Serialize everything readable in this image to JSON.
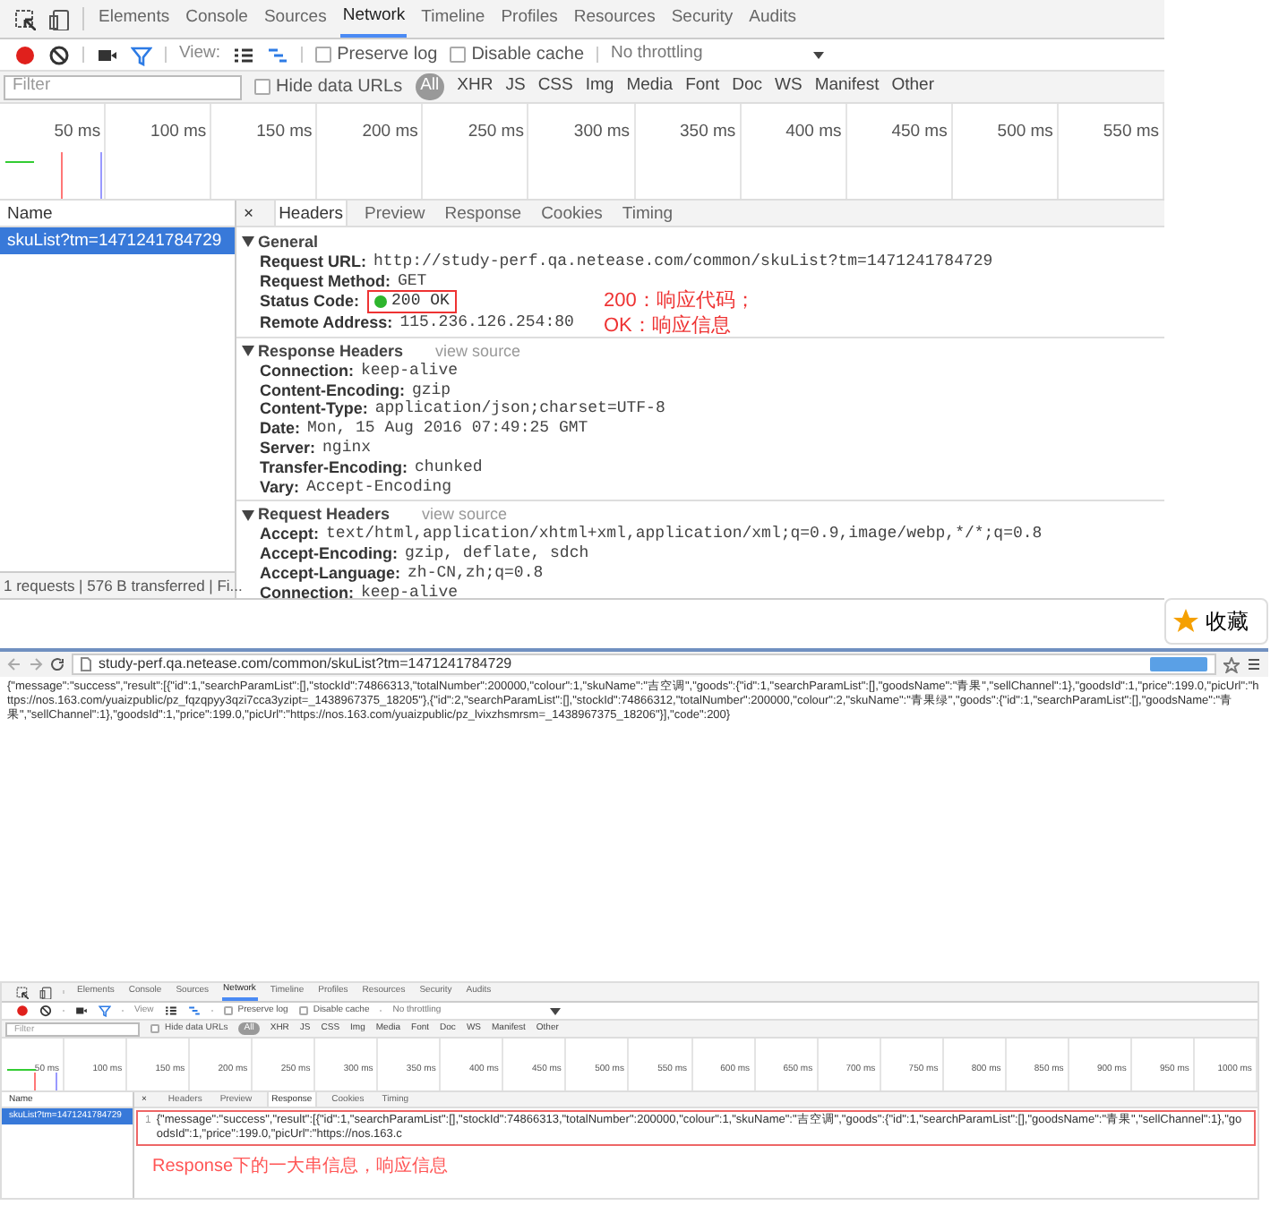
{
  "top_devtools": {
    "tabs": [
      {
        "label": "Elements",
        "selected": false
      },
      {
        "label": "Console",
        "selected": false
      },
      {
        "label": "Sources",
        "selected": false
      },
      {
        "label": "Network",
        "selected": true
      },
      {
        "label": "Timeline",
        "selected": false
      },
      {
        "label": "Profiles",
        "selected": false
      },
      {
        "label": "Resources",
        "selected": false
      },
      {
        "label": "Security",
        "selected": false
      },
      {
        "label": "Audits",
        "selected": false
      }
    ],
    "toolbar": {
      "view_label": "View:",
      "preserve_log": {
        "label": "Preserve log",
        "checked": false
      },
      "disable_cache": {
        "label": "Disable cache",
        "checked": false
      },
      "throttling": "No throttling"
    },
    "filter": {
      "placeholder": "Filter",
      "hide_data_urls": {
        "label": "Hide data URLs",
        "checked": false
      },
      "types": [
        {
          "label": "All",
          "selected": true
        },
        {
          "label": "XHR",
          "selected": false
        },
        {
          "label": "JS",
          "selected": false
        },
        {
          "label": "CSS",
          "selected": false
        },
        {
          "label": "Img",
          "selected": false
        },
        {
          "label": "Media",
          "selected": false
        },
        {
          "label": "Font",
          "selected": false
        },
        {
          "label": "Doc",
          "selected": false
        },
        {
          "label": "WS",
          "selected": false
        },
        {
          "label": "Manifest",
          "selected": false
        },
        {
          "label": "Other",
          "selected": false
        }
      ]
    },
    "timeline_ticks": [
      "50 ms",
      "100 ms",
      "150 ms",
      "200 ms",
      "250 ms",
      "300 ms",
      "350 ms",
      "400 ms",
      "450 ms",
      "500 ms",
      "550 ms"
    ],
    "requests": {
      "column": "Name",
      "items": [
        {
          "name": "skuList?tm=1471241784729",
          "selected": true
        }
      ],
      "status": "1 requests | 576 B transferred | Fi..."
    },
    "detail_close": "×",
    "detail_tabs": [
      {
        "label": "Headers",
        "selected": true
      },
      {
        "label": "Preview",
        "selected": false
      },
      {
        "label": "Response",
        "selected": false
      },
      {
        "label": "Cookies",
        "selected": false
      },
      {
        "label": "Timing",
        "selected": false
      }
    ],
    "sections": [
      {
        "title": "General",
        "expanded": true,
        "rows": [
          {
            "name": "Request URL:",
            "value": "http://study-perf.qa.netease.com/common/skuList?tm=1471241784729"
          },
          {
            "name": "Request Method:",
            "value": "GET"
          },
          {
            "name": "Status Code:",
            "value": "200 OK",
            "kind": "status"
          },
          {
            "name": "Remote Address:",
            "value": "115.236.126.254:80"
          }
        ]
      },
      {
        "title": "Response Headers",
        "expanded": true,
        "link": "view source",
        "rows": [
          {
            "name": "Connection:",
            "value": "keep-alive"
          },
          {
            "name": "Content-Encoding:",
            "value": "gzip"
          },
          {
            "name": "Content-Type:",
            "value": "application/json;charset=UTF-8"
          },
          {
            "name": "Date:",
            "value": "Mon, 15 Aug 2016 07:49:25 GMT"
          },
          {
            "name": "Server:",
            "value": "nginx"
          },
          {
            "name": "Transfer-Encoding:",
            "value": "chunked"
          },
          {
            "name": "Vary:",
            "value": "Accept-Encoding"
          }
        ]
      },
      {
        "title": "Request Headers",
        "expanded": true,
        "link": "view source",
        "rows": [
          {
            "name": "Accept:",
            "value": "text/html,application/xhtml+xml,application/xml;q=0.9,image/webp,*/*;q=0.8"
          },
          {
            "name": "Accept-Encoding:",
            "value": "gzip, deflate, sdch"
          },
          {
            "name": "Accept-Language:",
            "value": "zh-CN,zh;q=0.8"
          },
          {
            "name": "Connection:",
            "value": "keep-alive"
          }
        ]
      }
    ],
    "annotation": [
      "200：响应代码；",
      "OK：响应信息"
    ]
  },
  "favorite_button": "收藏",
  "browser": {
    "url": "study-perf.qa.netease.com/common/skuList?tm=1471241784729",
    "body": "{\"message\":\"success\",\"result\":[{\"id\":1,\"searchParamList\":[],\"stockId\":74866313,\"totalNumber\":200000,\"colour\":1,\"skuName\":\"吉空调\",\"goods\":{\"id\":1,\"searchParamList\":[],\"goodsName\":\"青果\",\"sellChannel\":1},\"goodsId\":1,\"price\":199.0,\"picUrl\":\"https://nos.163.com/yuaizpublic/pz_fqzqpyy3qzi7cca3yzipt=_1438967375_18205\"},{\"id\":2,\"searchParamList\":[],\"stockId\":74866312,\"totalNumber\":200000,\"colour\":2,\"skuName\":\"青果绿\",\"goods\":{\"id\":1,\"searchParamList\":[],\"goodsName\":\"青果\",\"sellChannel\":1},\"goodsId\":1,\"price\":199.0,\"picUrl\":\"https://nos.163.com/yuaizpublic/pz_lvixzhsmrsm=_1438967375_18206\"}],\"code\":200}"
  },
  "bottom_devtools": {
    "tabs": [
      {
        "label": "Elements",
        "selected": false
      },
      {
        "label": "Console",
        "selected": false
      },
      {
        "label": "Sources",
        "selected": false
      },
      {
        "label": "Network",
        "selected": true
      },
      {
        "label": "Timeline",
        "selected": false
      },
      {
        "label": "Profiles",
        "selected": false
      },
      {
        "label": "Resources",
        "selected": false
      },
      {
        "label": "Security",
        "selected": false
      },
      {
        "label": "Audits",
        "selected": false
      }
    ],
    "toolbar": {
      "view_label": "View",
      "preserve_log": {
        "label": "Preserve log",
        "checked": false
      },
      "disable_cache": {
        "label": "Disable cache",
        "checked": false
      },
      "throttling": "No throttling"
    },
    "filter": {
      "placeholder": "Filter",
      "hide_data_urls": {
        "label": "Hide data URLs",
        "checked": false
      },
      "types": [
        {
          "label": "All",
          "selected": true
        },
        {
          "label": "XHR",
          "selected": false
        },
        {
          "label": "JS",
          "selected": false
        },
        {
          "label": "CSS",
          "selected": false
        },
        {
          "label": "Img",
          "selected": false
        },
        {
          "label": "Media",
          "selected": false
        },
        {
          "label": "Font",
          "selected": false
        },
        {
          "label": "Doc",
          "selected": false
        },
        {
          "label": "WS",
          "selected": false
        },
        {
          "label": "Manifest",
          "selected": false
        },
        {
          "label": "Other",
          "selected": false
        }
      ]
    },
    "timeline_ticks": [
      "50 ms",
      "100 ms",
      "150 ms",
      "200 ms",
      "250 ms",
      "300 ms",
      "350 ms",
      "400 ms",
      "450 ms",
      "500 ms",
      "550 ms",
      "600 ms",
      "650 ms",
      "700 ms",
      "750 ms",
      "800 ms",
      "850 ms",
      "900 ms",
      "950 ms",
      "1000 ms"
    ],
    "requests": {
      "column": "Name",
      "items": [
        {
          "name": "skuList?tm=1471241784729",
          "selected": true
        }
      ]
    },
    "detail_close": "×",
    "detail_tabs": [
      {
        "label": "Headers",
        "selected": false
      },
      {
        "label": "Preview",
        "selected": false
      },
      {
        "label": "Response",
        "selected": true
      },
      {
        "label": "Cookies",
        "selected": false
      },
      {
        "label": "Timing",
        "selected": false
      }
    ],
    "response_line_number": "1",
    "response_text": "{\"message\":\"success\",\"result\":[{\"id\":1,\"searchParamList\":[],\"stockId\":74866313,\"totalNumber\":200000,\"colour\":1,\"skuName\":\"吉空调\",\"goods\":{\"id\":1,\"searchParamList\":[],\"goodsName\":\"青果\",\"sellChannel\":1},\"goodsId\":1,\"price\":199.0,\"picUrl\":\"https://nos.163.c",
    "annotation": "Response下的一大串信息，响应信息"
  }
}
